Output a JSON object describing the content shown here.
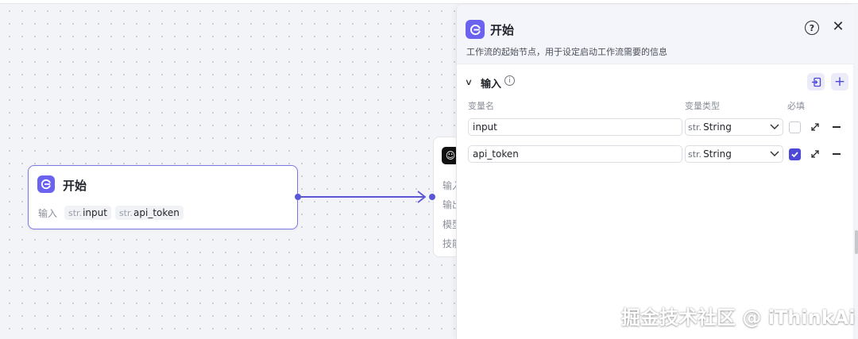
{
  "start_node": {
    "title": "开始",
    "input_label": "输入",
    "vars": [
      {
        "type": "str.",
        "name": "input"
      },
      {
        "type": "str.",
        "name": "api_token"
      }
    ]
  },
  "next_node": {
    "rows": [
      "输入",
      "输出",
      "模型",
      "技能"
    ]
  },
  "panel": {
    "title": "开始",
    "description": "工作流的起始节点，用于设定启动工作流需要的信息",
    "help_icon": "help-circle-icon",
    "close_icon": "close-icon",
    "section": {
      "title": "输入",
      "columns": {
        "name": "变量名",
        "type": "变量类型",
        "required": "必填"
      },
      "variables": [
        {
          "name": "input",
          "type_prefix": "str.",
          "type": "String",
          "required": false
        },
        {
          "name": "api_token",
          "type_prefix": "str.",
          "type": "String",
          "required": true
        }
      ]
    }
  },
  "colors": {
    "accent": "#5b56d6",
    "node_border": "#7b78e6",
    "checkbox_on": "#4e48d6"
  },
  "watermark": "掘金技术社区 @ iThinkAi"
}
